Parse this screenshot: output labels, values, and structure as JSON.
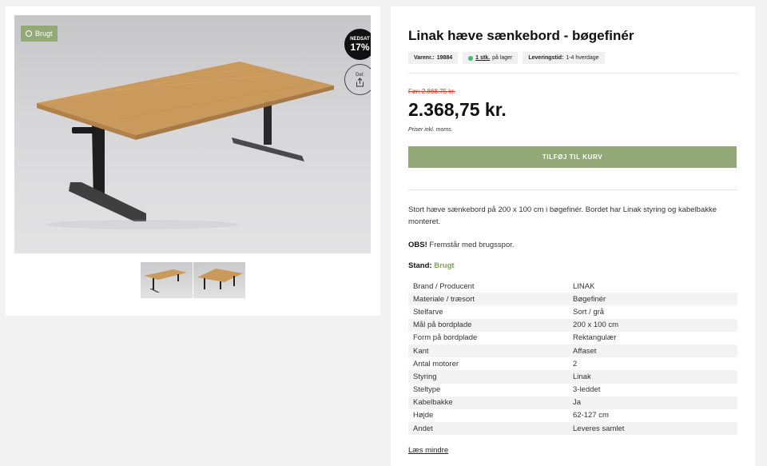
{
  "gallery": {
    "condition_badge": "Brugt",
    "discount_word": "NEDSAT",
    "discount_pct": "17%",
    "share_label": "Del:",
    "thumbnail_count": 2
  },
  "product": {
    "title": "Linak hæve sænkebord - bøgefinér",
    "sku_label": "Varenr.:",
    "sku": "19884",
    "stock_qty": "1 stk.",
    "stock_text": "på lager",
    "delivery_label": "Leveringstid:",
    "delivery": "1-4 hverdage",
    "old_price": "Før: 2.868,75 kr.",
    "price": "2.368,75 kr.",
    "vat_note": "Priser inkl. moms.",
    "cart_button": "TILFØJ TIL KURV",
    "description": "Stort hæve sænkebord på 200 x 100 cm i bøgefinér. Bordet har Linak styring og kabelbakke monteret.",
    "obs_label": "OBS!",
    "obs_text": "Fremstår med brugsspor.",
    "stand_label": "Stand:",
    "stand_value": "Brugt",
    "specs": [
      {
        "k": "Brand / Producent",
        "v": "LINAK"
      },
      {
        "k": "Materiale / træsort",
        "v": "Bøgefinér"
      },
      {
        "k": "Stelfarve",
        "v": "Sort / grå"
      },
      {
        "k": "Mål på bordplade",
        "v": "200 x 100 cm"
      },
      {
        "k": "Form på bordplade",
        "v": "Rektangulær"
      },
      {
        "k": "Kant",
        "v": "Affaset"
      },
      {
        "k": "Antal motorer",
        "v": "2"
      },
      {
        "k": "Styring",
        "v": "Linak"
      },
      {
        "k": "Steltype",
        "v": "3-leddet"
      },
      {
        "k": "Kabelbakke",
        "v": "Ja"
      },
      {
        "k": "Højde",
        "v": "62-127 cm"
      },
      {
        "k": "Andet",
        "v": "Leveres samlet"
      }
    ],
    "read_less": "Læs mindre"
  },
  "colors": {
    "accent_green": "#93aa78",
    "stand_green": "#7ea35c",
    "old_price_red": "#d9352a",
    "stock_dot": "#3bbf6a",
    "badge_black": "#111111"
  },
  "icons": [
    "refresh-circle-icon",
    "share-icon"
  ]
}
